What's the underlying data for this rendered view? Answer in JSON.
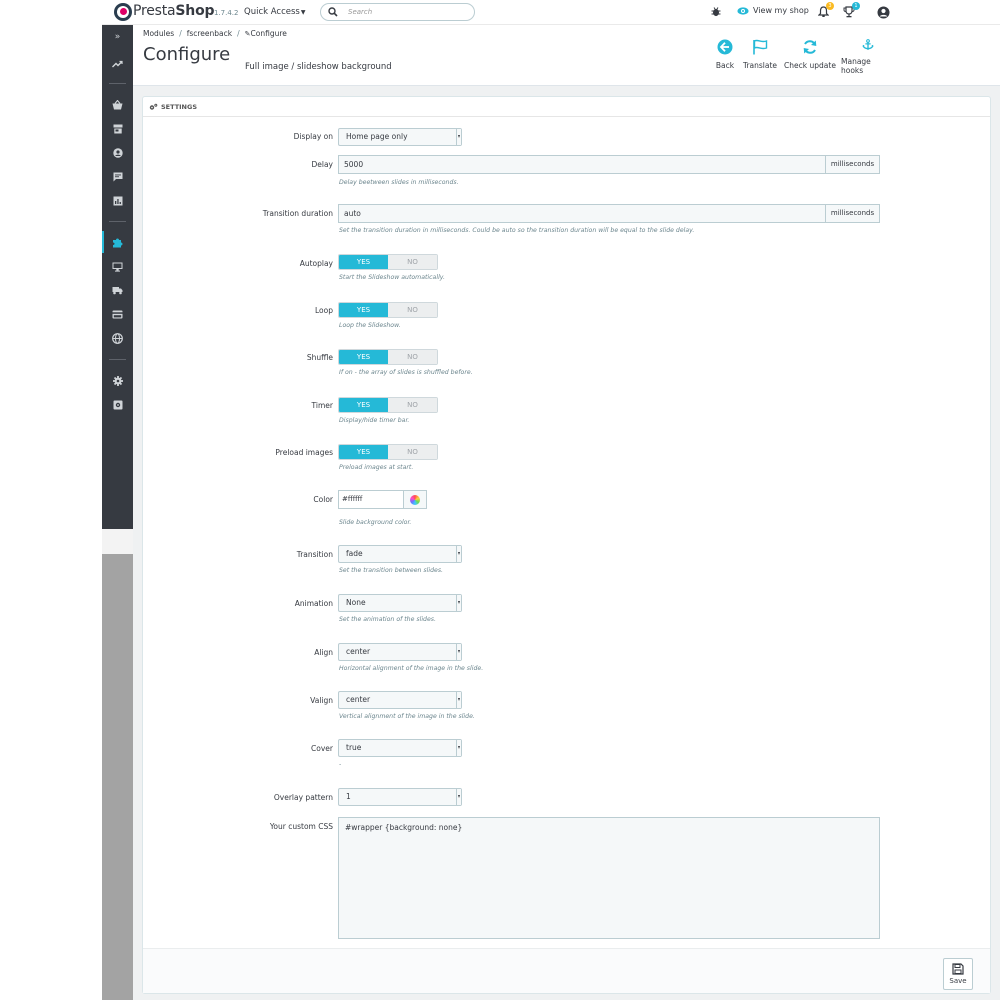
{
  "header": {
    "brand_pre": "Presta",
    "brand_bold": "Shop",
    "version": "1.7.4.2",
    "quick_access": "Quick Access",
    "search_placeholder": "Search",
    "view_shop": "View my shop",
    "notifications_count": "3",
    "orders_count": "1"
  },
  "breadcrumb": {
    "modules": "Modules",
    "module": "fscreenback",
    "current": "Configure"
  },
  "page": {
    "title": "Configure",
    "subtitle": "Full image / slideshow background"
  },
  "toolbar": {
    "back": "Back",
    "translate": "Translate",
    "check_update": "Check update",
    "manage_hooks": "Manage hooks"
  },
  "panel": {
    "title": "SETTINGS"
  },
  "form": {
    "display_on": {
      "label": "Display on",
      "value": "Home page only"
    },
    "delay": {
      "label": "Delay",
      "value": "5000",
      "unit": "milliseconds",
      "help": "Delay beetween slides in milliseconds."
    },
    "transition_duration": {
      "label": "Transition duration",
      "value": "auto",
      "unit": "milliseconds",
      "help": "Set the transition duration in milliseconds. Could be auto so the transition duration will be equal to the slide delay."
    },
    "autoplay": {
      "label": "Autoplay",
      "yes": "YES",
      "no": "NO",
      "help": "Start the Slideshow automatically."
    },
    "loop": {
      "label": "Loop",
      "yes": "YES",
      "no": "NO",
      "help": "Loop the Slideshow."
    },
    "shuffle": {
      "label": "Shuffle",
      "yes": "YES",
      "no": "NO",
      "help": "If on - the array of slides is shuffled before."
    },
    "timer": {
      "label": "Timer",
      "yes": "YES",
      "no": "NO",
      "help": "Display/hide timer bar."
    },
    "preload": {
      "label": "Preload images",
      "yes": "YES",
      "no": "NO",
      "help": "Preload images at start."
    },
    "color": {
      "label": "Color",
      "value": "#ffffff",
      "help": "Slide background color."
    },
    "transition": {
      "label": "Transition",
      "value": "fade",
      "help": "Set the transition between slides."
    },
    "animation": {
      "label": "Animation",
      "value": "None",
      "help": "Set the animation of the slides."
    },
    "align": {
      "label": "Align",
      "value": "center",
      "help": "Horizontal alignment of the image in the slide."
    },
    "valign": {
      "label": "Valign",
      "value": "center",
      "help": "Vertical alignment of the image in the slide."
    },
    "cover": {
      "label": "Cover",
      "value": "true",
      "help": "-"
    },
    "overlay": {
      "label": "Overlay pattern",
      "value": "1"
    },
    "custom_css": {
      "label": "Your custom CSS",
      "value": "#wrapper {background: none}"
    }
  },
  "footer": {
    "save": "Save"
  },
  "colors": {
    "accent": "#25b9d7",
    "sidebar": "#363a41"
  }
}
